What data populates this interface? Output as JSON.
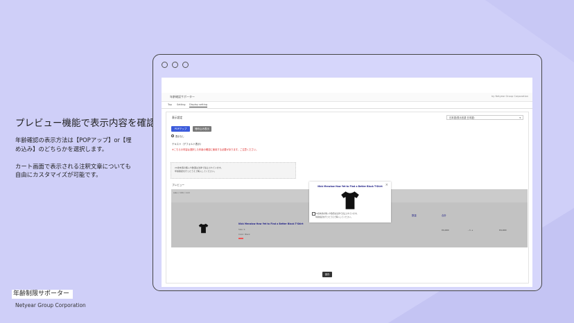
{
  "slide": {
    "heading": "プレビュー機能で表示内容を確認",
    "desc_lines": [
      "年齢確認の表示方法は【POPアップ】or【埋",
      "め込み】のどちらかを選択します。",
      "",
      "カート画面で表示される注釈文章についても",
      "自由にカスタマイズが可能です。"
    ],
    "brand_name": "年齢制限サポーター",
    "brand_corp": "Netyear Group Corporation"
  },
  "app": {
    "title": "年齢確認サポーター",
    "account": "by Netyear Group Corporation",
    "tabs": [
      "Top",
      "Setting",
      "Display setting"
    ],
    "display_setting": {
      "section_label": "表示設定",
      "language_select": "日本語(表示言語 日本語)",
      "mode_buttons": [
        "POPアップ",
        "埋め込み表示"
      ],
      "radio_label": "表示なし",
      "text_label": "テキスト（デフォルト表示）",
      "red_notice": "※こちらの内容は選択した年齢の確認に使用する必要があります。ご注意ください。",
      "message_lines": [
        "20歳未満の購入や飲酒は法律で禁止されています。",
        "年齢確認を行ったうえで購入してください。"
      ],
      "preview_label": "プレビュー",
      "save_label": "保存"
    },
    "preview": {
      "top_text": "sale / 100 / com",
      "product_name": "Nick Menzlow How Yet to Find a Better Black T-Shirt",
      "meta_lines": [
        "Size: S",
        "Color: Black"
      ],
      "qty_header": "数量",
      "total_header": "合計",
      "price": "¥4,000",
      "qty": "- 1 +",
      "total": "¥4,000"
    },
    "modal": {
      "title": "Nick Menzlow How Yet to Find a Better Black T-Shirt",
      "close": "×",
      "lines": [
        "20歳未満の購入や飲酒は法律で禁止されています。",
        "年齢確認を行ったうえで購入してください。"
      ]
    }
  },
  "colors": {
    "background": "#cfcff8",
    "frame": "#d6d6fb",
    "primary_button": "#3b5bdb",
    "secondary_button": "#777777",
    "notice_red": "#dd2222"
  }
}
